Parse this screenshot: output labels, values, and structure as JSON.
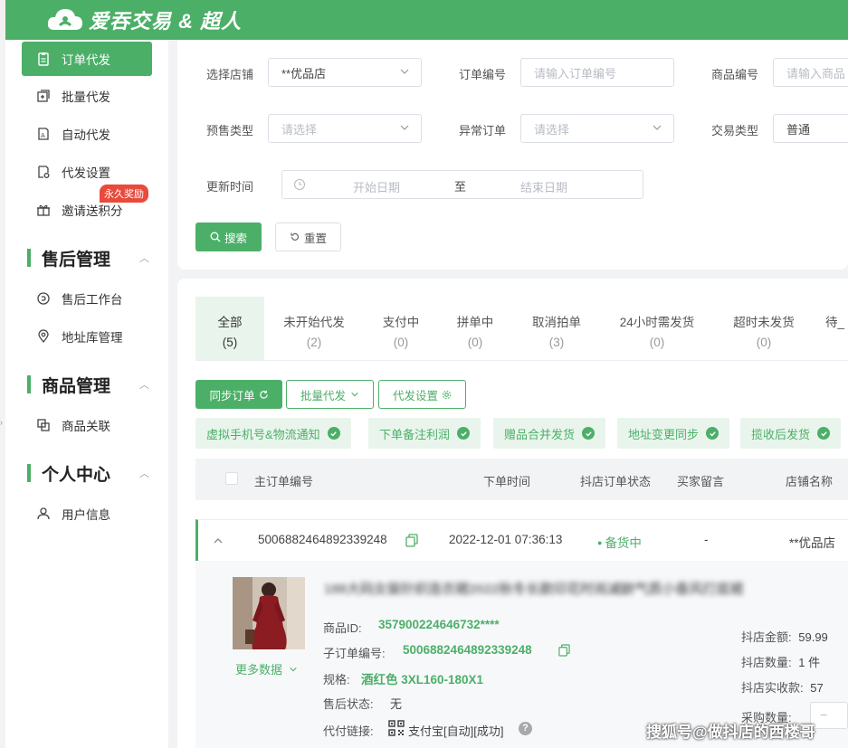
{
  "header": {
    "brand": "爱吞交易 & 超人"
  },
  "sidebar": {
    "items": [
      {
        "label": "订单代发",
        "icon": "clipboard-icon",
        "active": true
      },
      {
        "label": "批量代发",
        "icon": "batch-send-icon"
      },
      {
        "label": "自动代发",
        "icon": "auto-send-icon"
      },
      {
        "label": "代发设置",
        "icon": "settings-doc-icon"
      },
      {
        "label": "邀请送积分",
        "icon": "gift-icon"
      }
    ],
    "reward_badge": "永久奖励",
    "sections": [
      {
        "title": "售后管理",
        "items": [
          {
            "label": "售后工作台",
            "icon": "refresh-circle-icon"
          },
          {
            "label": "地址库管理",
            "icon": "location-pin-icon"
          }
        ]
      },
      {
        "title": "商品管理",
        "items": [
          {
            "label": "商品关联",
            "icon": "link-icon"
          }
        ]
      },
      {
        "title": "个人中心",
        "items": [
          {
            "label": "用户信息",
            "icon": "user-icon"
          }
        ]
      }
    ]
  },
  "filters": {
    "store": {
      "label": "选择店铺",
      "value": "**优品店"
    },
    "order_no": {
      "label": "订单编号",
      "placeholder": "请输入订单编号"
    },
    "product_no": {
      "label": "商品编号",
      "placeholder": "请输入商品"
    },
    "presale": {
      "label": "预售类型",
      "placeholder": "请选择"
    },
    "abnormal": {
      "label": "异常订单",
      "placeholder": "请选择"
    },
    "trade_type": {
      "label": "交易类型",
      "value": "普通"
    },
    "update_time": {
      "label": "更新时间",
      "start_placeholder": "开始日期",
      "separator": "至",
      "end_placeholder": "结束日期"
    },
    "search_label": "搜索",
    "reset_label": "重置"
  },
  "tabs": [
    {
      "label": "全部",
      "count": "(5)",
      "active": true
    },
    {
      "label": "未开始代发",
      "count": "(2)"
    },
    {
      "label": "支付中",
      "count": "(0)"
    },
    {
      "label": "拼单中",
      "count": "(0)"
    },
    {
      "label": "取消拍单",
      "count": "(3)"
    },
    {
      "label": "24小时需发货",
      "count": "(0)"
    },
    {
      "label": "超时未发货",
      "count": "(0)"
    },
    {
      "label": "待_",
      "count": ""
    }
  ],
  "actions": {
    "sync": "同步订单",
    "batch": "批量代发",
    "settings": "代发设置"
  },
  "chips": [
    "虚拟手机号&物流通知",
    "下单备注利润",
    "赠品合并发货",
    "地址变更同步",
    "揽收后发货"
  ],
  "table": {
    "headers": [
      "主订单编号",
      "下单时间",
      "抖店订单状态",
      "买家留言",
      "店铺名称"
    ]
  },
  "order": {
    "id": "5006882464892339248",
    "time": "2022-12-01 07:36:13",
    "status": "备货中",
    "note": "-",
    "store": "**优品店",
    "title_blurred": "188大码女装针织连衣裙2022秋冬长款印花时尚减龄气质小香风打底裙",
    "product_id_label": "商品ID:",
    "product_id": "357900224646732****",
    "sub_order_label": "子订单编号:",
    "sub_order": "5006882464892339248",
    "spec_label": "规格:",
    "spec": "酒红色 3XL160-180X1",
    "after_sale_label": "售后状态:",
    "after_sale": "无",
    "pay_link_label": "代付链接:",
    "pay_link": "支付宝[自动][成功]",
    "more_data": "更多数据",
    "amount_label": "抖店金额:",
    "amount": "59.99",
    "qty_label": "抖店数量:",
    "qty": "1 件",
    "received_label": "抖店实收款:",
    "received": "57",
    "purchase_qty_label": "采购数量:"
  },
  "watermark": "搜狐号@做抖店的西楼哥",
  "colors": {
    "accent": "#4caf68",
    "badge": "#e84a3c"
  }
}
